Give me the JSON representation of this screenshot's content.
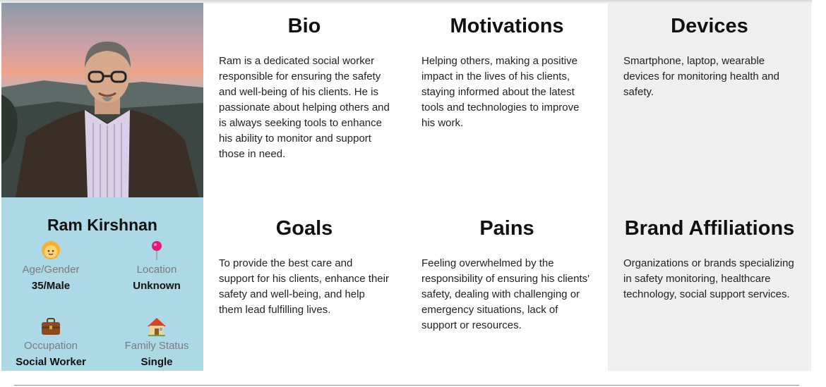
{
  "persona": {
    "name": "Ram Kirshnan",
    "attributes": [
      {
        "icon": "person-face-icon",
        "label": "Age/Gender",
        "value": "35/Male"
      },
      {
        "icon": "location-pin-icon",
        "label": "Location",
        "value": "Unknown"
      },
      {
        "icon": "briefcase-icon",
        "label": "Occupation",
        "value": "Social Worker"
      },
      {
        "icon": "house-icon",
        "label": "Family Status",
        "value": "Single"
      }
    ]
  },
  "sections": {
    "bio": {
      "title": "Bio",
      "text": "Ram is a dedicated social worker responsible for ensuring the safety and well-being of his clients. He is passionate about helping others and is always seeking tools to enhance his ability to monitor and support those in need."
    },
    "motivations": {
      "title": "Motivations",
      "text": "Helping others, making a positive impact in the lives of his clients, staying informed about the latest tools and technologies to improve his work."
    },
    "devices": {
      "title": "Devices",
      "text": "Smartphone, laptop, wearable devices for monitoring health and safety."
    },
    "goals": {
      "title": "Goals",
      "text": "To provide the best care and support for his clients, enhance their safety and well-being, and help them lead fulfilling lives."
    },
    "pains": {
      "title": "Pains",
      "text": "Feeling overwhelmed by the responsibility of ensuring his clients' safety, dealing with challenging or emergency situations, lack of support or resources."
    },
    "brand_affiliations": {
      "title": "Brand Affiliations",
      "text": "Organizations or brands specializing in safety monitoring, healthcare technology, social support services."
    }
  },
  "colors": {
    "profile_panel": "#add8e6",
    "devices_column": "#efefef"
  }
}
